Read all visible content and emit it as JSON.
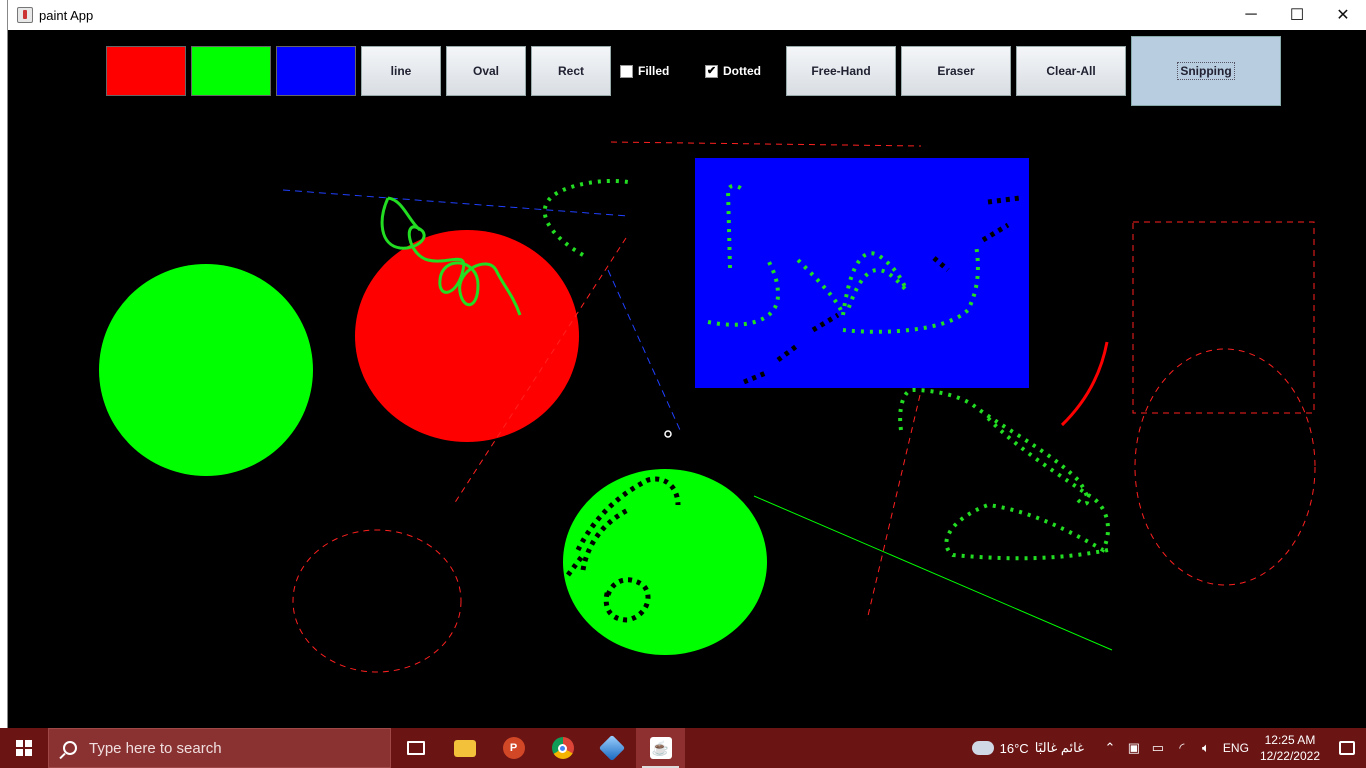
{
  "window": {
    "title": "paint App",
    "controls": {
      "minimize": "─",
      "maximize": "☐",
      "close": "✕"
    }
  },
  "toolbar": {
    "colors": [
      {
        "name": "red",
        "hex": "#ff0000"
      },
      {
        "name": "green",
        "hex": "#00ff00"
      },
      {
        "name": "blue",
        "hex": "#0000ff"
      }
    ],
    "line_label": "line",
    "oval_label": "Oval",
    "rect_label": "Rect",
    "filled_label": "Filled",
    "filled_checked": false,
    "dotted_label": "Dotted",
    "dotted_checked": true,
    "freehand_label": "Free-Hand",
    "eraser_label": "Eraser",
    "clearall_label": "Clear-All",
    "snipping_label": "Snipping"
  },
  "taskbar": {
    "search_placeholder": "Type here to search",
    "apps": [
      {
        "name": "task-view-icon"
      },
      {
        "name": "file-explorer-icon"
      },
      {
        "name": "powerpoint-icon"
      },
      {
        "name": "chrome-icon"
      },
      {
        "name": "virtualbox-icon"
      },
      {
        "name": "java-icon"
      }
    ],
    "weather_temp": "16°C",
    "weather_text": "غائم غالبًا",
    "language": "ENG",
    "time": "12:25 AM",
    "date": "12/22/2022"
  }
}
